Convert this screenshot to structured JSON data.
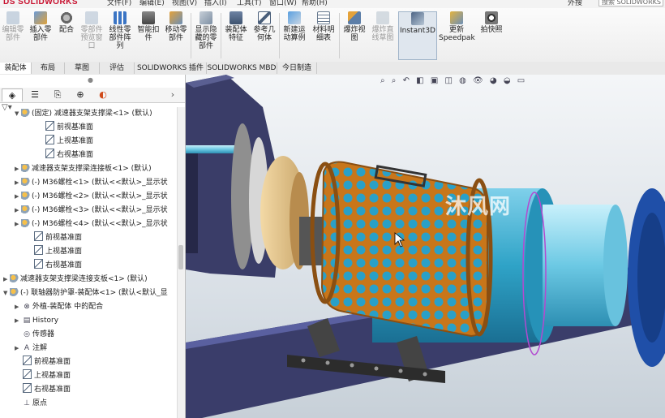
{
  "app": {
    "logo": "DS SOLIDWORKS"
  },
  "menu": {
    "items": [
      "文件(F)",
      "编辑(E)",
      "视图(V)",
      "插入(I)",
      "工具(T)",
      "窗口(W)",
      "帮助(H)"
    ],
    "right_label": "外搜",
    "search_placeholder": "搜索 SOLIDWORKS"
  },
  "toolbar": {
    "buttons": [
      {
        "label": "编辑零\n部件",
        "icon": "edit-component-icon",
        "disabled": true
      },
      {
        "label": "插入零\n部件",
        "icon": "insert-component-icon",
        "disabled": false
      },
      {
        "label": "配合",
        "icon": "mate-icon",
        "disabled": false
      },
      {
        "label": "零部件\n预览窗\n口",
        "icon": "component-preview-icon",
        "disabled": true
      },
      {
        "label": "线性零\n部件阵\n列",
        "icon": "linear-pattern-icon",
        "disabled": false
      },
      {
        "label": "智能扣\n件",
        "icon": "smart-fastener-icon",
        "disabled": false
      },
      {
        "label": "移动零\n部件",
        "icon": "move-component-icon",
        "disabled": false
      },
      {
        "label": "显示隐\n藏的零\n部件",
        "icon": "show-hidden-icon",
        "disabled": false
      },
      {
        "label": "装配体\n特征",
        "icon": "assembly-feature-icon",
        "disabled": false
      },
      {
        "label": "参考几\n何体",
        "icon": "reference-geometry-icon",
        "disabled": false
      },
      {
        "label": "新建运\n动算例",
        "icon": "motion-study-icon",
        "disabled": false
      },
      {
        "label": "材料明\n细表",
        "icon": "bom-icon",
        "disabled": false
      },
      {
        "label": "爆炸视\n图",
        "icon": "exploded-view-icon",
        "disabled": false
      },
      {
        "label": "爆炸直\n线草图",
        "icon": "explode-line-icon",
        "disabled": true
      },
      {
        "label": "Instant3D",
        "icon": "instant3d-icon",
        "disabled": false,
        "active": true
      },
      {
        "label": "更新\nSpeedpak",
        "icon": "speedpak-icon",
        "disabled": false
      },
      {
        "label": "拍快照",
        "icon": "snapshot-icon",
        "disabled": false
      }
    ]
  },
  "tabs": [
    "装配体",
    "布局",
    "草图",
    "评估",
    "SOLIDWORKS 插件",
    "SOLIDWORKS MBD",
    "今日制造"
  ],
  "tree": {
    "rows": [
      {
        "text": "(固定) 减速器支架支撑梁<1> (默认)",
        "indent": 1,
        "expander": "▼",
        "kind": "part"
      },
      {
        "text": "前视基准面",
        "indent": 3,
        "expander": "",
        "kind": "plane"
      },
      {
        "text": "上视基准面",
        "indent": 3,
        "expander": "",
        "kind": "plane"
      },
      {
        "text": "右视基准面",
        "indent": 3,
        "expander": "",
        "kind": "plane"
      },
      {
        "text": "减速器支架支撑梁连接板<1> (默认)",
        "indent": 1,
        "expander": "▶",
        "kind": "part"
      },
      {
        "text": "(-) M36螺栓<1> (默认<<默认>_显示状",
        "indent": 1,
        "expander": "▶",
        "kind": "part"
      },
      {
        "text": "(-) M36螺栓<2> (默认<<默认>_显示状",
        "indent": 1,
        "expander": "▶",
        "kind": "part"
      },
      {
        "text": "(-) M36螺栓<3> (默认<<默认>_显示状",
        "indent": 1,
        "expander": "▶",
        "kind": "part"
      },
      {
        "text": "(-) M36螺栓<4> (默认<<默认>_显示状",
        "indent": 1,
        "expander": "▶",
        "kind": "part"
      },
      {
        "text": "前视基准面",
        "indent": 2,
        "expander": "",
        "kind": "plane"
      },
      {
        "text": "上视基准面",
        "indent": 2,
        "expander": "",
        "kind": "plane"
      },
      {
        "text": "右视基准面",
        "indent": 2,
        "expander": "",
        "kind": "plane"
      },
      {
        "text": "减速器支架支撑梁连接支板<1> (默认)",
        "indent": 0,
        "expander": "▶",
        "kind": "part"
      },
      {
        "text": "(-) 联轴器防护罩-装配体<1> (默认<默认_显",
        "indent": 0,
        "expander": "▼",
        "kind": "part"
      },
      {
        "text": "外植-装配体 中的配合",
        "indent": 1,
        "expander": "▶",
        "kind": "mates"
      },
      {
        "text": "History",
        "indent": 1,
        "expander": "▶",
        "kind": "history"
      },
      {
        "text": "传感器",
        "indent": 1,
        "expander": "",
        "kind": "sensor"
      },
      {
        "text": "注解",
        "indent": 1,
        "expander": "▶",
        "kind": "annotation"
      },
      {
        "text": "前视基准面",
        "indent": 1,
        "expander": "",
        "kind": "plane"
      },
      {
        "text": "上视基准面",
        "indent": 1,
        "expander": "",
        "kind": "plane"
      },
      {
        "text": "右视基准面",
        "indent": 1,
        "expander": "",
        "kind": "plane"
      },
      {
        "text": "原点",
        "indent": 1,
        "expander": "",
        "kind": "origin"
      }
    ]
  },
  "viewport": {
    "watermark": "沐风网"
  },
  "colors": {
    "cage": "#c8761a",
    "cylinder": "#31a6c9",
    "frame": "#3c3f6a",
    "coupling": "#1f4fa8"
  }
}
